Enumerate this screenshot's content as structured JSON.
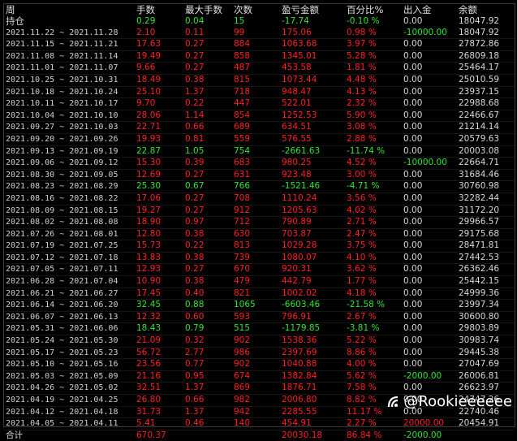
{
  "header": [
    "周",
    "手数",
    "最大手数",
    "次数",
    "盈亏金额",
    "百分比%",
    "出入金",
    "余额"
  ],
  "holding": {
    "label": "持仓",
    "lots": "0.29",
    "max_lots": "0.04",
    "count": "15",
    "pnl": "-17.74",
    "pct": "-0.10 %",
    "flow": "0.00",
    "balance": "18047.92"
  },
  "rows": [
    {
      "week": "2021.11.22 ~ 2021.11.28",
      "lots": "2.10",
      "max_lots": "0.11",
      "count": "99",
      "pnl": "175.06",
      "pct": "0.98 %",
      "flow": "-10000.00",
      "balance": "18047.92",
      "sign": "pos",
      "flow_sign": "neg"
    },
    {
      "week": "2021.11.15 ~ 2021.11.21",
      "lots": "17.63",
      "max_lots": "0.27",
      "count": "884",
      "pnl": "1063.68",
      "pct": "3.97 %",
      "flow": "0.00",
      "balance": "27872.86",
      "sign": "pos"
    },
    {
      "week": "2021.11.08 ~ 2021.11.14",
      "lots": "19.49",
      "max_lots": "0.27",
      "count": "858",
      "pnl": "1345.01",
      "pct": "5.28 %",
      "flow": "0.00",
      "balance": "26809.18",
      "sign": "pos"
    },
    {
      "week": "2021.11.01 ~ 2021.11.07",
      "lots": "9.66",
      "max_lots": "0.27",
      "count": "487",
      "pnl": "453.58",
      "pct": "1.81 %",
      "flow": "0.00",
      "balance": "25464.17",
      "sign": "pos"
    },
    {
      "week": "2021.10.25 ~ 2021.10.31",
      "lots": "18.49",
      "max_lots": "0.38",
      "count": "815",
      "pnl": "1073.44",
      "pct": "4.48 %",
      "flow": "0.00",
      "balance": "25010.59",
      "sign": "pos"
    },
    {
      "week": "2021.10.18 ~ 2021.10.24",
      "lots": "25.10",
      "max_lots": "1.37",
      "count": "718",
      "pnl": "948.47",
      "pct": "4.13 %",
      "flow": "0.00",
      "balance": "23937.15",
      "sign": "pos"
    },
    {
      "week": "2021.10.11 ~ 2021.10.17",
      "lots": "9.70",
      "max_lots": "0.22",
      "count": "447",
      "pnl": "522.01",
      "pct": "2.32 %",
      "flow": "0.00",
      "balance": "22988.68",
      "sign": "pos"
    },
    {
      "week": "2021.10.04 ~ 2021.10.10",
      "lots": "28.06",
      "max_lots": "1.14",
      "count": "854",
      "pnl": "1252.53",
      "pct": "5.90 %",
      "flow": "0.00",
      "balance": "22466.67",
      "sign": "pos"
    },
    {
      "week": "2021.09.27 ~ 2021.10.03",
      "lots": "22.71",
      "max_lots": "0.66",
      "count": "689",
      "pnl": "634.51",
      "pct": "3.08 %",
      "flow": "0.00",
      "balance": "21214.14",
      "sign": "pos"
    },
    {
      "week": "2021.09.20 ~ 2021.09.26",
      "lots": "19.93",
      "max_lots": "0.81",
      "count": "559",
      "pnl": "576.55",
      "pct": "2.88 %",
      "flow": "0.00",
      "balance": "20579.63",
      "sign": "pos"
    },
    {
      "week": "2021.09.13 ~ 2021.09.19",
      "lots": "22.87",
      "max_lots": "1.05",
      "count": "754",
      "pnl": "-2661.63",
      "pct": "-11.74 %",
      "flow": "0.00",
      "balance": "20003.08",
      "sign": "neg"
    },
    {
      "week": "2021.09.06 ~ 2021.09.12",
      "lots": "15.30",
      "max_lots": "0.39",
      "count": "683",
      "pnl": "980.25",
      "pct": "4.52 %",
      "flow": "-10000.00",
      "balance": "22664.71",
      "sign": "pos",
      "flow_sign": "neg"
    },
    {
      "week": "2021.08.30 ~ 2021.09.05",
      "lots": "12.69",
      "max_lots": "0.27",
      "count": "631",
      "pnl": "923.48",
      "pct": "3.00 %",
      "flow": "0.00",
      "balance": "31684.46",
      "sign": "pos"
    },
    {
      "week": "2021.08.23 ~ 2021.08.29",
      "lots": "25.30",
      "max_lots": "0.67",
      "count": "766",
      "pnl": "-1521.46",
      "pct": "-4.71 %",
      "flow": "0.00",
      "balance": "30760.98",
      "sign": "neg"
    },
    {
      "week": "2021.08.16 ~ 2021.08.22",
      "lots": "17.06",
      "max_lots": "0.27",
      "count": "708",
      "pnl": "1110.24",
      "pct": "3.56 %",
      "flow": "0.00",
      "balance": "32282.44",
      "sign": "pos"
    },
    {
      "week": "2021.08.09 ~ 2021.08.15",
      "lots": "19.27",
      "max_lots": "0.27",
      "count": "912",
      "pnl": "1205.63",
      "pct": "4.02 %",
      "flow": "0.00",
      "balance": "31172.20",
      "sign": "pos"
    },
    {
      "week": "2021.08.02 ~ 2021.08.08",
      "lots": "18.90",
      "max_lots": "0.97",
      "count": "712",
      "pnl": "790.89",
      "pct": "2.71 %",
      "flow": "0.00",
      "balance": "29966.57",
      "sign": "pos"
    },
    {
      "week": "2021.07.26 ~ 2021.08.01",
      "lots": "12.80",
      "max_lots": "0.38",
      "count": "630",
      "pnl": "703.87",
      "pct": "2.47 %",
      "flow": "0.00",
      "balance": "29175.68",
      "sign": "pos"
    },
    {
      "week": "2021.07.19 ~ 2021.07.25",
      "lots": "15.73",
      "max_lots": "0.22",
      "count": "813",
      "pnl": "1029.28",
      "pct": "3.75 %",
      "flow": "0.00",
      "balance": "28471.81",
      "sign": "pos"
    },
    {
      "week": "2021.07.12 ~ 2021.07.18",
      "lots": "13.83",
      "max_lots": "0.38",
      "count": "739",
      "pnl": "1080.07",
      "pct": "4.10 %",
      "flow": "0.00",
      "balance": "27442.53",
      "sign": "pos"
    },
    {
      "week": "2021.07.05 ~ 2021.07.11",
      "lots": "12.93",
      "max_lots": "0.27",
      "count": "670",
      "pnl": "920.31",
      "pct": "3.62 %",
      "flow": "0.00",
      "balance": "26362.46",
      "sign": "pos"
    },
    {
      "week": "2021.06.28 ~ 2021.07.04",
      "lots": "10.90",
      "max_lots": "0.38",
      "count": "479",
      "pnl": "442.79",
      "pct": "1.77 %",
      "flow": "0.00",
      "balance": "25442.15",
      "sign": "pos"
    },
    {
      "week": "2021.06.21 ~ 2021.06.27",
      "lots": "17.45",
      "max_lots": "0.40",
      "count": "821",
      "pnl": "1002.02",
      "pct": "4.18 %",
      "flow": "0.00",
      "balance": "24999.36",
      "sign": "pos"
    },
    {
      "week": "2021.06.14 ~ 2021.06.20",
      "lots": "32.45",
      "max_lots": "0.88",
      "count": "1065",
      "pnl": "-6603.46",
      "pct": "-21.58 %",
      "flow": "0.00",
      "balance": "23997.34",
      "sign": "neg"
    },
    {
      "week": "2021.06.07 ~ 2021.06.13",
      "lots": "12.32",
      "max_lots": "0.60",
      "count": "593",
      "pnl": "796.91",
      "pct": "2.67 %",
      "flow": "0.00",
      "balance": "30600.80",
      "sign": "pos"
    },
    {
      "week": "2021.05.31 ~ 2021.06.06",
      "lots": "18.43",
      "max_lots": "0.79",
      "count": "515",
      "pnl": "-1179.85",
      "pct": "-3.81 %",
      "flow": "0.00",
      "balance": "29803.89",
      "sign": "neg"
    },
    {
      "week": "2021.05.24 ~ 2021.05.30",
      "lots": "21.09",
      "max_lots": "0.32",
      "count": "902",
      "pnl": "1538.36",
      "pct": "5.22 %",
      "flow": "0.00",
      "balance": "30983.74",
      "sign": "pos"
    },
    {
      "week": "2021.05.17 ~ 2021.05.23",
      "lots": "56.72",
      "max_lots": "2.77",
      "count": "986",
      "pnl": "2397.69",
      "pct": "8.86 %",
      "flow": "0.00",
      "balance": "29445.38",
      "sign": "pos"
    },
    {
      "week": "2021.05.10 ~ 2021.05.16",
      "lots": "23.56",
      "max_lots": "0.77",
      "count": "902",
      "pnl": "1040.88",
      "pct": "4.00 %",
      "flow": "0.00",
      "balance": "27047.69",
      "sign": "pos"
    },
    {
      "week": "2021.05.03 ~ 2021.05.09",
      "lots": "21.16",
      "max_lots": "0.95",
      "count": "674",
      "pnl": "1382.84",
      "pct": "5.62 %",
      "flow": "-2000.00",
      "balance": "26006.81",
      "sign": "pos",
      "flow_sign": "neg"
    },
    {
      "week": "2021.04.26 ~ 2021.05.02",
      "lots": "32.51",
      "max_lots": "1.37",
      "count": "869",
      "pnl": "1876.71",
      "pct": "7.58 %",
      "flow": "0.00",
      "balance": "26623.97",
      "sign": "pos"
    },
    {
      "week": "2021.04.19 ~ 2021.04.25",
      "lots": "26.80",
      "max_lots": "0.66",
      "count": "982",
      "pnl": "2006.80",
      "pct": "8.82 %",
      "flow": "0.00",
      "balance": "24747.26",
      "sign": "pos"
    },
    {
      "week": "2021.04.12 ~ 2021.04.18",
      "lots": "31.73",
      "max_lots": "1.37",
      "count": "942",
      "pnl": "2285.55",
      "pct": "11.17 %",
      "flow": "0.00",
      "balance": "22740.46",
      "sign": "pos"
    },
    {
      "week": "2021.04.05 ~ 2021.04.11",
      "lots": "5.41",
      "max_lots": "0.46",
      "count": "140",
      "pnl": "454.91",
      "pct": "2.27 %",
      "flow": "20000.00",
      "balance": "20454.91",
      "sign": "pos",
      "flow_sign": "pos"
    }
  ],
  "total": {
    "label": "合计",
    "lots": "670.37",
    "pnl": "20030.18",
    "pct": "86.84 %",
    "flow": "-2000.00"
  },
  "watermark": {
    "text": "@Rookieeeeee"
  },
  "colors": {
    "profit": "#ff2020",
    "loss": "#2fe62f",
    "neutral": "#d8d8d8",
    "background": "#000000"
  }
}
